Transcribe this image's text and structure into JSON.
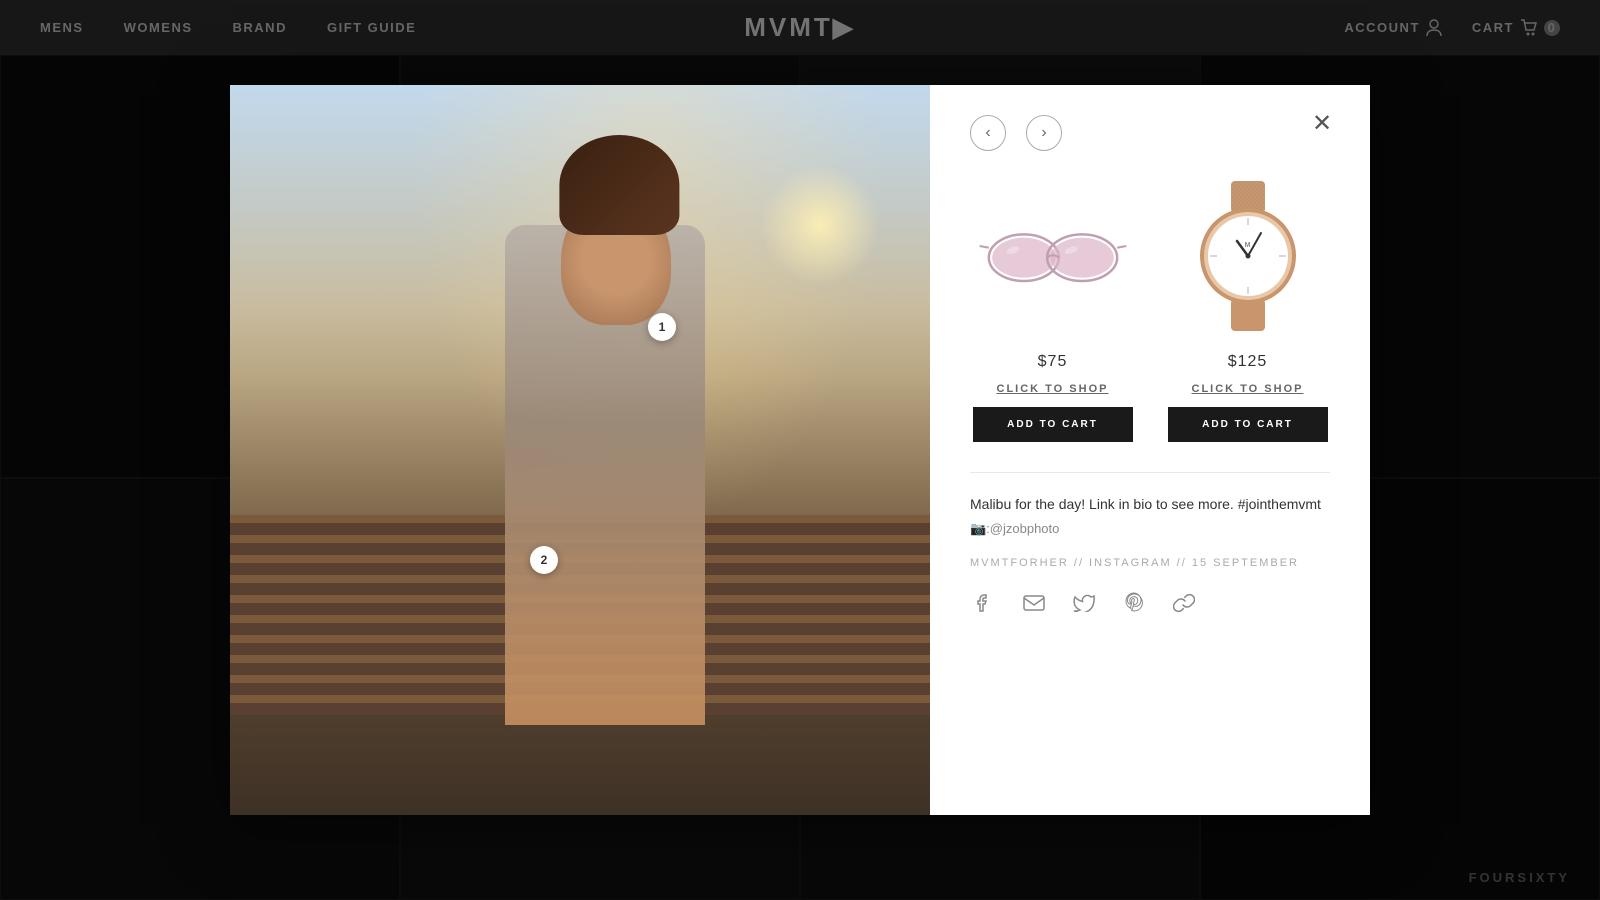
{
  "nav": {
    "links": [
      "MENS",
      "WOMENS",
      "BRAND",
      "GIFT GUIDE"
    ],
    "brand": "MVMT◀",
    "brand_display": "MVMT▶",
    "account_label": "ACCOUNT",
    "cart_label": "CART",
    "cart_count": "0"
  },
  "modal": {
    "product1": {
      "price": "$75",
      "cta": "CLICK TO SHOP",
      "add_btn": "ADD TO CART",
      "hotspot_num": "1",
      "alt": "Rose gold mirrored sunglasses"
    },
    "product2": {
      "price": "$125",
      "cta": "CLICK TO SHOP",
      "add_btn": "ADD TO CART",
      "hotspot_num": "2",
      "alt": "Rose gold mesh band watch"
    },
    "caption": "Malibu for the day! Link in bio to see more. #jointhemvmt",
    "credit": "📷:@jzobphoto",
    "meta": "MVMTFORHER // INSTAGRAM // 15 SEPTEMBER",
    "social": {
      "facebook": "f",
      "email": "✉",
      "twitter": "t",
      "pinterest": "p",
      "link": "🔗"
    }
  },
  "footer": {
    "brand": "FOURSIXTY"
  }
}
